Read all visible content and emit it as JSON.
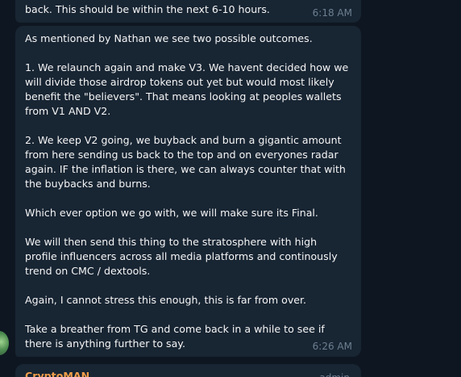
{
  "messages": {
    "previous": {
      "text": "back. This should be within the next 6-10 hours.",
      "time": "6:18 AM"
    },
    "main": {
      "text": "As mentioned by Nathan we see two possible outcomes.\n\n1. We relaunch again and make V3. We havent decided how we will divide those airdrop tokens out yet but would most likely benefit the \"believers\". That means looking at peoples wallets from V1 AND V2.\n\n2. We keep V2 going, we buyback and burn a gigantic amount from here sending us back to the top and on everyones radar again. IF the inflation is there, we can always counter that with the buybacks and burns.\n\nWhich ever option we go with, we will make sure its Final.\n\nWe will then send this thing to the stratosphere with high profile influencers across all media platforms and continously trend on CMC / dextools.\n\nAgain, I cannot stress this enough, this is far from over.\n\nTake a breather from TG and come back in a while to see if there is anything further to say.",
      "time": "6:26 AM"
    },
    "next": {
      "sender": "CryptoMAN",
      "role": "admin"
    }
  },
  "colors": {
    "background": "#0e1621",
    "bubble": "#182533",
    "sender": "#f09d49",
    "meta": "#6d7f8f"
  }
}
